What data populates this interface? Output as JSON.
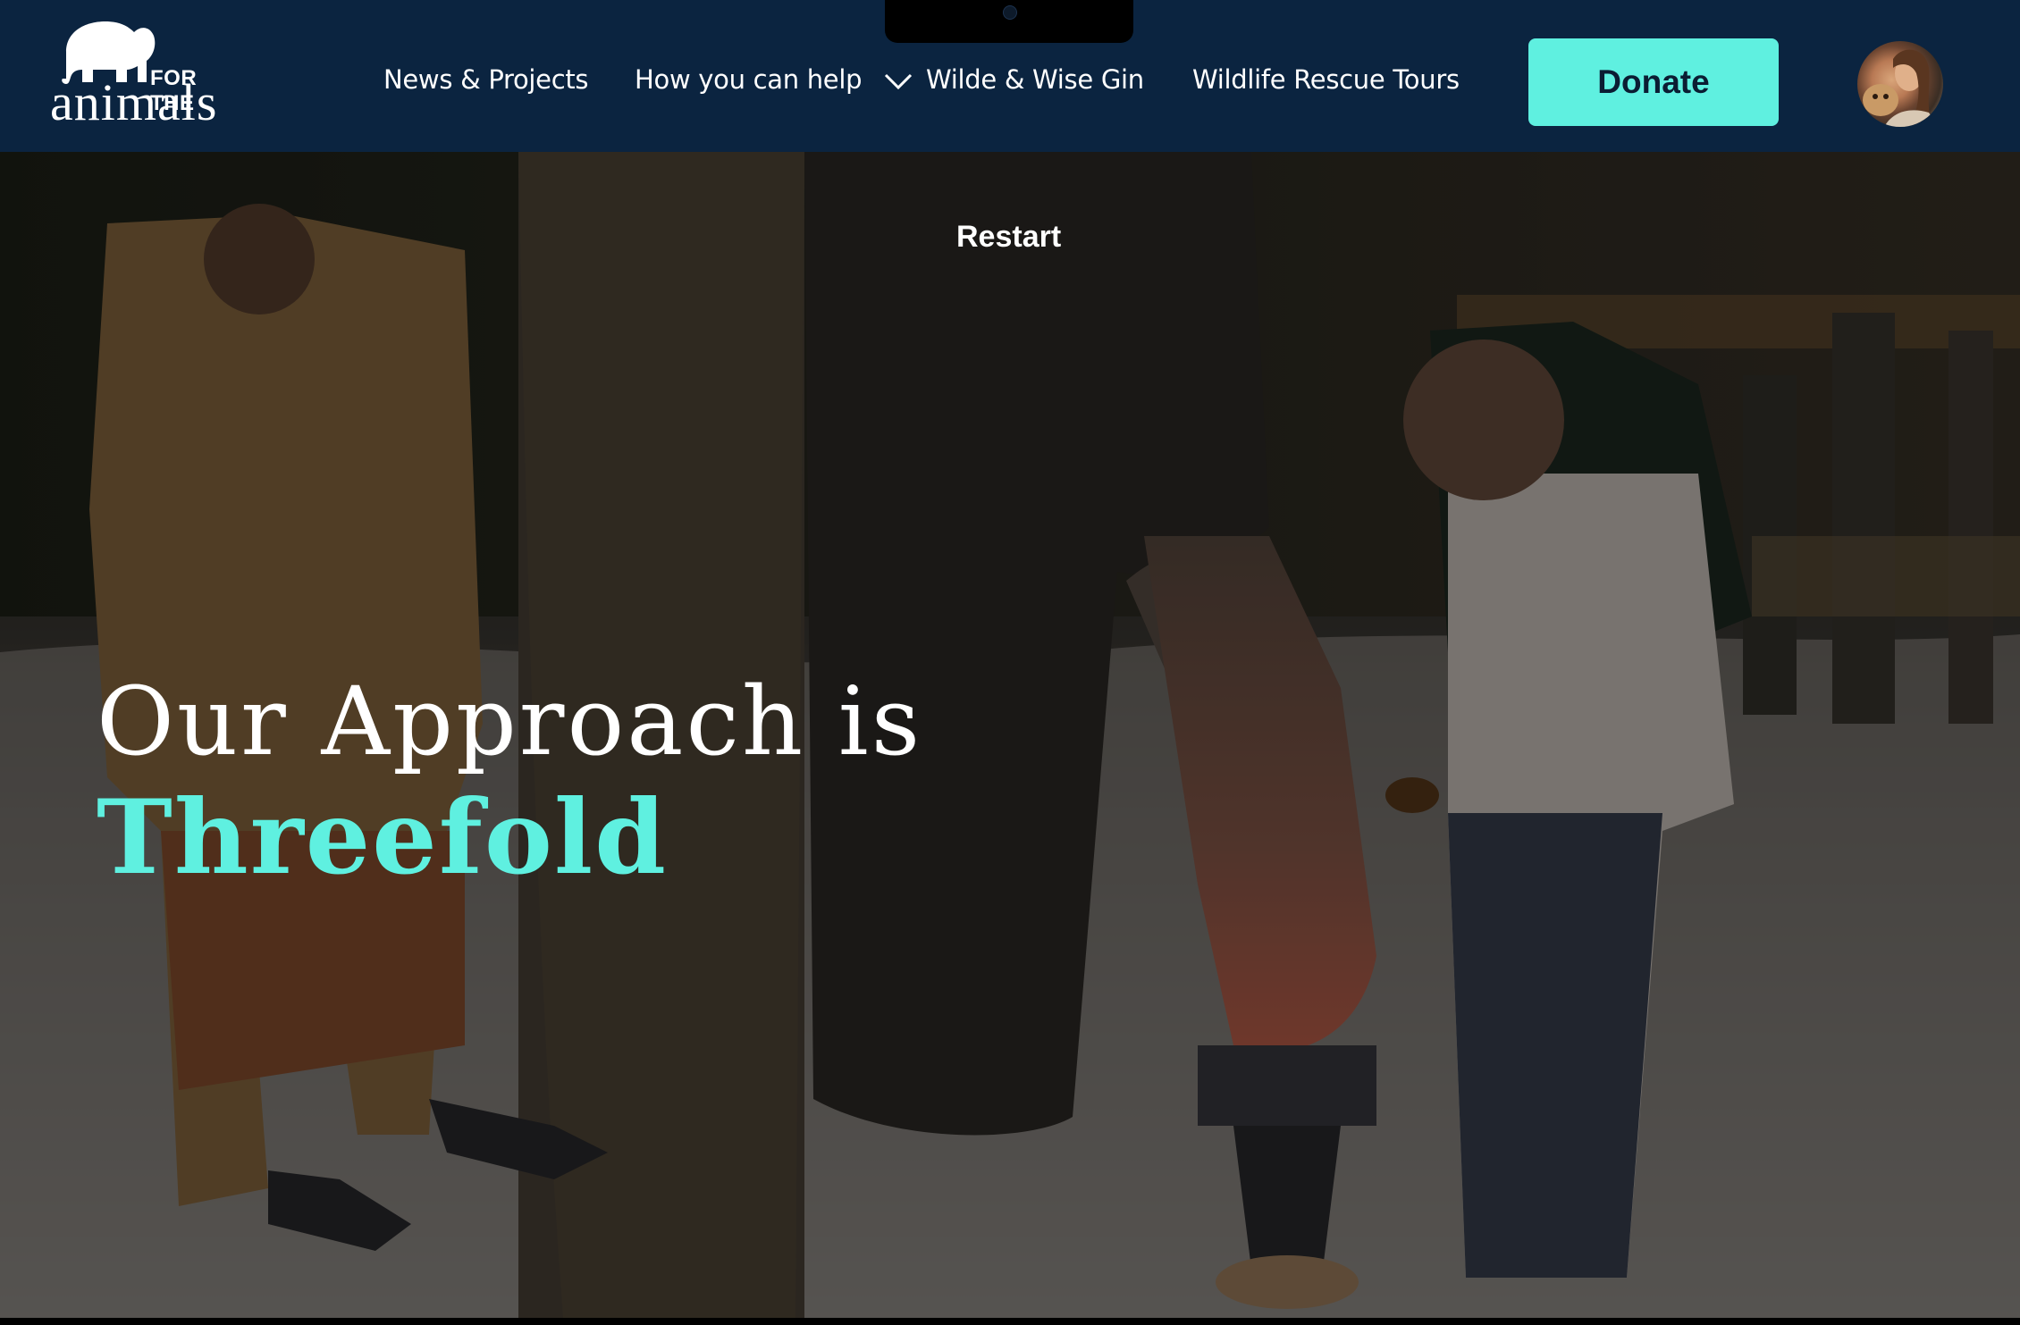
{
  "header": {
    "logo": {
      "for_the": "FOR THE",
      "animals": "animals",
      "icon": "elephant-icon"
    },
    "nav": [
      {
        "label": "News & Projects"
      },
      {
        "label": "How you can help",
        "icon": "chevron-down-icon"
      },
      {
        "label": "Wilde & Wise Gin"
      },
      {
        "label": "Wildlife Rescue Tours"
      }
    ],
    "donate_label": "Donate",
    "avatar_icon": "user-avatar"
  },
  "hero": {
    "restart_label": "Restart",
    "heading_line1": "Our Approach is",
    "heading_line2": "Threefold"
  },
  "colors": {
    "header_bg": "#0b2440",
    "accent": "#5ff0e0",
    "donate_text": "#0b1d33"
  }
}
